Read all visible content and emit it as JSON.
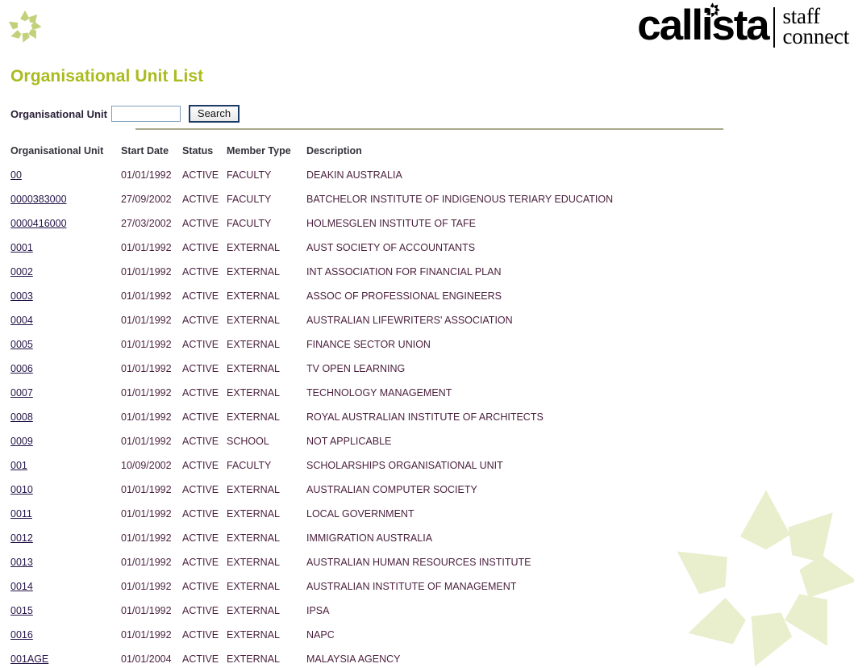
{
  "branding": {
    "star_icon": "callista-star-icon",
    "logo_word": "callista",
    "logo_staff": "staff",
    "logo_connect": "connect"
  },
  "page": {
    "title": "Organisational Unit List"
  },
  "search": {
    "label": "Organisational Unit",
    "value": "",
    "placeholder": "",
    "button_label": "Search"
  },
  "table": {
    "headers": {
      "unit": "Organisational Unit",
      "start_date": "Start Date",
      "status": "Status",
      "member_type": "Member Type",
      "description": "Description"
    },
    "rows": [
      {
        "unit": "00",
        "start_date": "01/01/1992",
        "status": "ACTIVE",
        "member_type": "FACULTY",
        "description": "DEAKIN AUSTRALIA"
      },
      {
        "unit": "0000383000",
        "start_date": "27/09/2002",
        "status": "ACTIVE",
        "member_type": "FACULTY",
        "description": "BATCHELOR INSTITUTE OF INDIGENOUS TERIARY EDUCATION"
      },
      {
        "unit": "0000416000",
        "start_date": "27/03/2002",
        "status": "ACTIVE",
        "member_type": "FACULTY",
        "description": "HOLMESGLEN INSTITUTE OF TAFE"
      },
      {
        "unit": "0001",
        "start_date": "01/01/1992",
        "status": "ACTIVE",
        "member_type": "EXTERNAL",
        "description": "AUST SOCIETY OF ACCOUNTANTS"
      },
      {
        "unit": "0002",
        "start_date": "01/01/1992",
        "status": "ACTIVE",
        "member_type": "EXTERNAL",
        "description": "INT ASSOCIATION FOR FINANCIAL PLAN"
      },
      {
        "unit": "0003",
        "start_date": "01/01/1992",
        "status": "ACTIVE",
        "member_type": "EXTERNAL",
        "description": "ASSOC OF PROFESSIONAL ENGINEERS"
      },
      {
        "unit": "0004",
        "start_date": "01/01/1992",
        "status": "ACTIVE",
        "member_type": "EXTERNAL",
        "description": "AUSTRALIAN LIFEWRITERS' ASSOCIATION"
      },
      {
        "unit": "0005",
        "start_date": "01/01/1992",
        "status": "ACTIVE",
        "member_type": "EXTERNAL",
        "description": "FINANCE SECTOR UNION"
      },
      {
        "unit": "0006",
        "start_date": "01/01/1992",
        "status": "ACTIVE",
        "member_type": "EXTERNAL",
        "description": "TV OPEN LEARNING"
      },
      {
        "unit": "0007",
        "start_date": "01/01/1992",
        "status": "ACTIVE",
        "member_type": "EXTERNAL",
        "description": "TECHNOLOGY MANAGEMENT"
      },
      {
        "unit": "0008",
        "start_date": "01/01/1992",
        "status": "ACTIVE",
        "member_type": "EXTERNAL",
        "description": "ROYAL AUSTRALIAN INSTITUTE OF ARCHITECTS"
      },
      {
        "unit": "0009",
        "start_date": "01/01/1992",
        "status": "ACTIVE",
        "member_type": "SCHOOL",
        "description": "NOT APPLICABLE"
      },
      {
        "unit": "001",
        "start_date": "10/09/2002",
        "status": "ACTIVE",
        "member_type": "FACULTY",
        "description": "SCHOLARSHIPS ORGANISATIONAL UNIT"
      },
      {
        "unit": "0010",
        "start_date": "01/01/1992",
        "status": "ACTIVE",
        "member_type": "EXTERNAL",
        "description": "AUSTRALIAN COMPUTER SOCIETY"
      },
      {
        "unit": "0011",
        "start_date": "01/01/1992",
        "status": "ACTIVE",
        "member_type": "EXTERNAL",
        "description": "LOCAL GOVERNMENT"
      },
      {
        "unit": "0012",
        "start_date": "01/01/1992",
        "status": "ACTIVE",
        "member_type": "EXTERNAL",
        "description": "IMMIGRATION AUSTRALIA"
      },
      {
        "unit": "0013",
        "start_date": "01/01/1992",
        "status": "ACTIVE",
        "member_type": "EXTERNAL",
        "description": "AUSTRALIAN HUMAN RESOURCES INSTITUTE"
      },
      {
        "unit": "0014",
        "start_date": "01/01/1992",
        "status": "ACTIVE",
        "member_type": "EXTERNAL",
        "description": "AUSTRALIAN INSTITUTE OF MANAGEMENT"
      },
      {
        "unit": "0015",
        "start_date": "01/01/1992",
        "status": "ACTIVE",
        "member_type": "EXTERNAL",
        "description": "IPSA"
      },
      {
        "unit": "0016",
        "start_date": "01/01/1992",
        "status": "ACTIVE",
        "member_type": "EXTERNAL",
        "description": "NAPC"
      },
      {
        "unit": "001AGE",
        "start_date": "01/01/2004",
        "status": "ACTIVE",
        "member_type": "EXTERNAL",
        "description": "MALAYSIA AGENCY"
      }
    ]
  },
  "decor": {
    "watermark_icon": "callista-star-watermark"
  },
  "colors": {
    "title_green": "#aabb1e",
    "brand_star_green": "#c2d17a",
    "watermark_green": "#e9eecd",
    "rule_khaki": "#a9a98c",
    "link_navy": "#231447",
    "text_maroon": "#4a1f3d",
    "button_border_navy": "#1b3a66",
    "input_border_blue": "#7f9db9"
  }
}
